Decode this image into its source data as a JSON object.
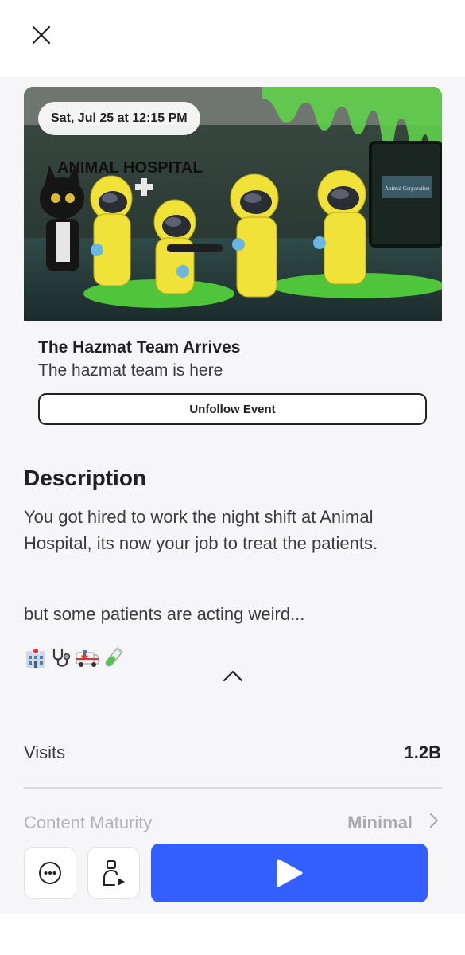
{
  "header": {
    "close_icon": "close-icon"
  },
  "event": {
    "date": "Sat, Jul 25 at 12:15 PM",
    "image_sign": "ANIMAL HOSPITAL",
    "image_door_sign": "Animal Corporation",
    "title": "The Hazmat Team Arrives",
    "subtitle": "The hazmat team is here",
    "unfollow_label": "Unfollow Event"
  },
  "description": {
    "heading": "Description",
    "lines": [
      "You got hired to work the night shift at Animal",
      "Hospital, its now your job to treat the patients.",
      "but some patients are acting weird..."
    ],
    "emojis": [
      "hospital-emoji",
      "stethoscope-emoji",
      "ambulance-emoji",
      "test-tube-emoji"
    ],
    "collapse_icon": "chevron-up-icon"
  },
  "stats": {
    "visits_label": "Visits",
    "visits_value": "1.2B",
    "maturity_label": "Content Maturity",
    "maturity_value": "Minimal"
  },
  "actions": {
    "more_icon": "more-options-icon",
    "share_icon": "play-with-friend-icon",
    "play_icon": "play-icon"
  },
  "colors": {
    "accent": "#335fff",
    "background": "#f6f6f8",
    "text": "#202124"
  }
}
